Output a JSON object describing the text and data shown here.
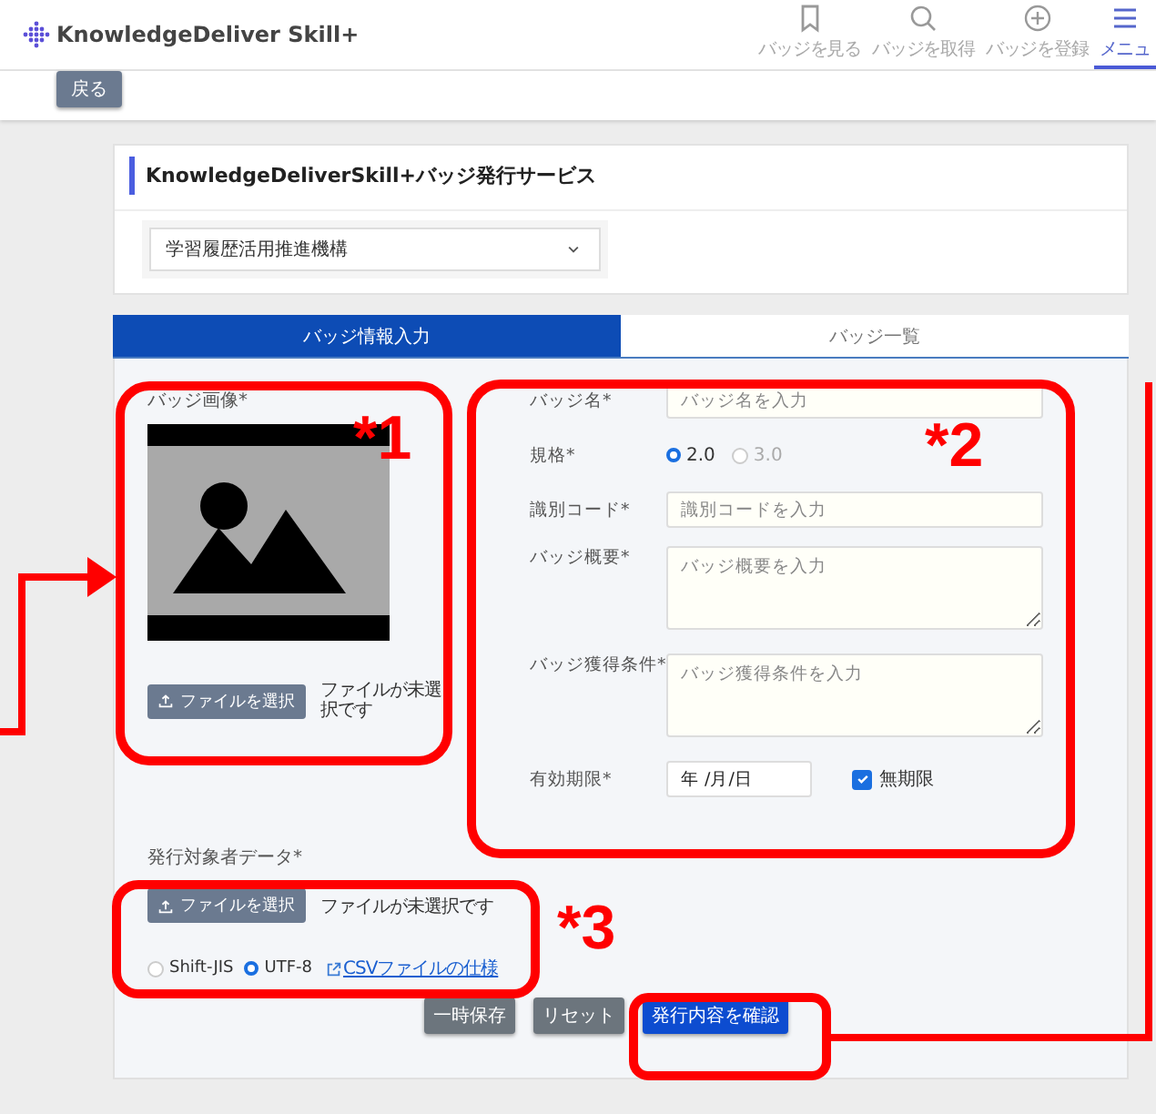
{
  "header": {
    "logo": "KnowledgeDeliver Skill+",
    "nav": [
      {
        "label": "バッジを見る",
        "selected": false
      },
      {
        "label": "バッジを取得",
        "selected": false
      },
      {
        "label": "バッジを登録",
        "selected": false
      },
      {
        "label": "メニュ",
        "selected": true
      }
    ]
  },
  "back_button": "戻る",
  "service": {
    "title": "KnowledgeDeliverSkill+バッジ発行サービス",
    "organization": "学習履歴活用推進機構"
  },
  "tabs": [
    {
      "label": "バッジ情報入力",
      "selected": true
    },
    {
      "label": "バッジ一覧",
      "selected": false
    }
  ],
  "badge_image": {
    "label": "バッジ画像*",
    "upload_button": "ファイルを選択",
    "file_status": "ファイルが未選択です"
  },
  "fields": [
    {
      "kind": "text",
      "label": "バッジ名*",
      "placeholder": "バッジ名を入力"
    },
    {
      "kind": "radio",
      "label": "規格*",
      "options": [
        {
          "label": "2.0",
          "selected": true
        },
        {
          "label": "3.0",
          "selected": false
        }
      ]
    },
    {
      "kind": "text",
      "label": "識別コード*",
      "placeholder": "識別コードを入力"
    },
    {
      "kind": "textarea",
      "label": "バッジ概要*",
      "placeholder": "バッジ概要を入力"
    },
    {
      "kind": "textarea",
      "label": "バッジ獲得条件*",
      "placeholder": "バッジ獲得条件を入力"
    },
    {
      "kind": "date",
      "label": "有効期限*",
      "value": "年 /月/日",
      "checkbox": {
        "label": "無期限",
        "checked": true
      }
    }
  ],
  "recipients": {
    "label": "発行対象者データ*",
    "upload_button": "ファイルを選択",
    "file_status": "ファイルが未選択です",
    "encodings": [
      {
        "label": "Shift-JIS",
        "selected": false
      },
      {
        "label": "UTF-8",
        "selected": true
      }
    ],
    "link": "CSVファイルの仕様"
  },
  "buttons": [
    {
      "label": "一時保存",
      "kind": "secondary"
    },
    {
      "label": "リセット",
      "kind": "secondary"
    },
    {
      "label": "発行内容を確認",
      "kind": "primary"
    }
  ],
  "annotations": [
    "*1",
    "*2",
    "*3"
  ]
}
